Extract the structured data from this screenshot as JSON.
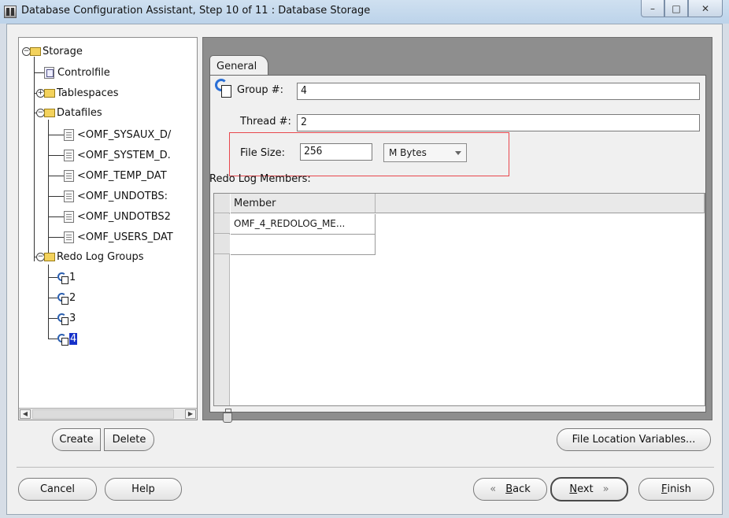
{
  "window": {
    "title": "Database Configuration Assistant, Step 10 of 11 : Database Storage",
    "controls": {
      "minimize": "–",
      "maximize": "□",
      "close": "✕"
    }
  },
  "tree": {
    "root": "Storage",
    "controlfile": "Controlfile",
    "tablespaces": "Tablespaces",
    "datafiles": "Datafiles",
    "datafile_items": [
      "<OMF_SYSAUX_D/",
      "<OMF_SYSTEM_D.",
      "<OMF_TEMP_DAT",
      "<OMF_UNDOTBS:",
      "<OMF_UNDOTBS2",
      "<OMF_USERS_DAT"
    ],
    "redo_log_groups": "Redo Log Groups",
    "groups": [
      "1",
      "2",
      "3",
      "4"
    ],
    "selected_group": "4"
  },
  "tab": {
    "label": "General"
  },
  "form": {
    "group_label": "Group #:",
    "group_value": "4",
    "thread_label": "Thread #:",
    "thread_value": "2",
    "file_size_label": "File Size:",
    "file_size_value": "256",
    "unit_value": "M Bytes",
    "redo_members_label": "Redo Log Members:"
  },
  "table": {
    "columns": [
      "Member"
    ],
    "rows": [
      "OMF_4_REDOLOG_ME...",
      ""
    ]
  },
  "buttons": {
    "create": "Create",
    "delete": "Delete",
    "file_location_variables": "File Location Variables...",
    "cancel": "Cancel",
    "help": "Help",
    "back_arrow": "«",
    "back_b": "B",
    "back_rest": "ack",
    "next_n": "N",
    "next_rest": "ext",
    "next_arrow": "»",
    "finish_f": "F",
    "finish_rest": "inish"
  },
  "colors": {
    "selection": "#1631c9",
    "highlight_box": "#e8474d",
    "panel_gray": "#8e8e8e"
  }
}
